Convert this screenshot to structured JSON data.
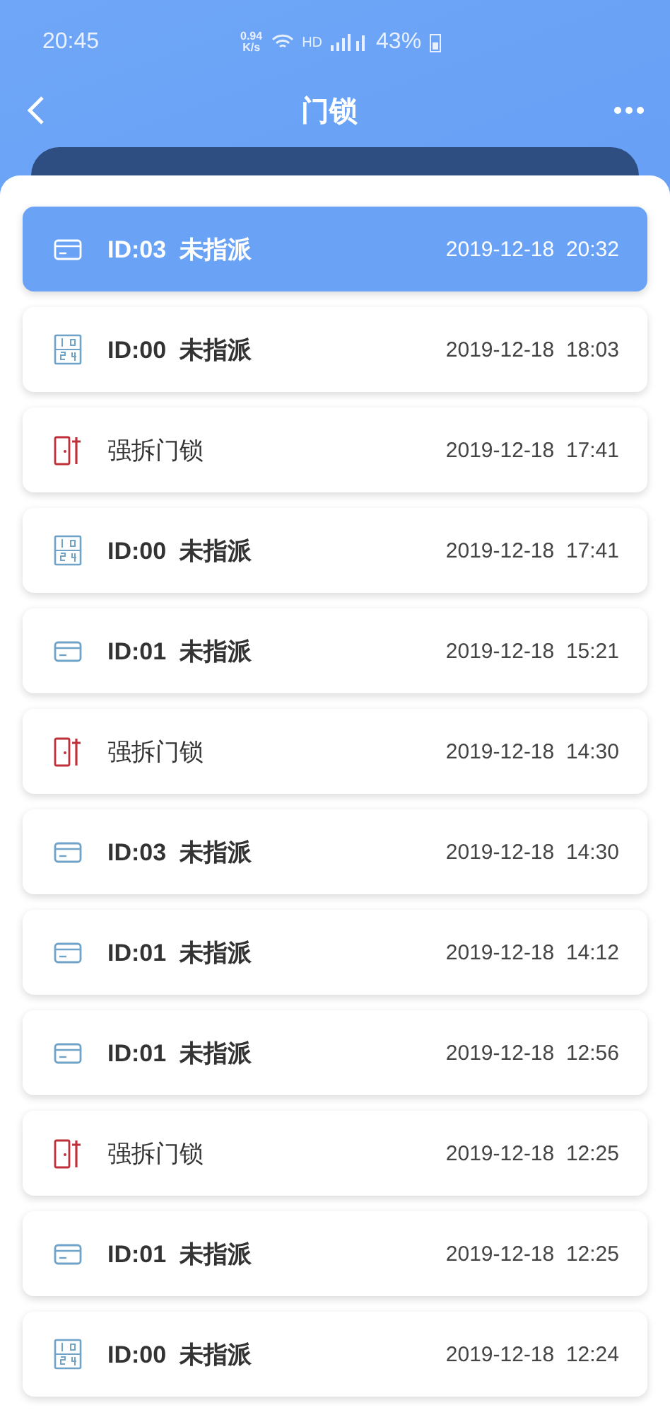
{
  "status_bar": {
    "time": "20:45",
    "speed": "0.94\nK/s",
    "hd": "HD",
    "battery": "43%"
  },
  "header": {
    "title": "门锁"
  },
  "records": [
    {
      "kind": "card",
      "label": "ID:03  未指派",
      "time": "2019-12-18  20:32",
      "selected": true
    },
    {
      "kind": "code",
      "label": "ID:00  未指派",
      "time": "2019-12-18  18:03",
      "selected": false
    },
    {
      "kind": "alarm",
      "label": "强拆门锁",
      "time": "2019-12-18  17:41",
      "selected": false
    },
    {
      "kind": "code",
      "label": "ID:00  未指派",
      "time": "2019-12-18  17:41",
      "selected": false
    },
    {
      "kind": "card",
      "label": "ID:01  未指派",
      "time": "2019-12-18  15:21",
      "selected": false
    },
    {
      "kind": "alarm",
      "label": "强拆门锁",
      "time": "2019-12-18  14:30",
      "selected": false
    },
    {
      "kind": "card",
      "label": "ID:03  未指派",
      "time": "2019-12-18  14:30",
      "selected": false
    },
    {
      "kind": "card",
      "label": "ID:01  未指派",
      "time": "2019-12-18  14:12",
      "selected": false
    },
    {
      "kind": "card",
      "label": "ID:01  未指派",
      "time": "2019-12-18  12:56",
      "selected": false
    },
    {
      "kind": "alarm",
      "label": "强拆门锁",
      "time": "2019-12-18  12:25",
      "selected": false
    },
    {
      "kind": "card",
      "label": "ID:01  未指派",
      "time": "2019-12-18  12:25",
      "selected": false
    },
    {
      "kind": "code",
      "label": "ID:00  未指派",
      "time": "2019-12-18  12:24",
      "selected": false
    }
  ]
}
